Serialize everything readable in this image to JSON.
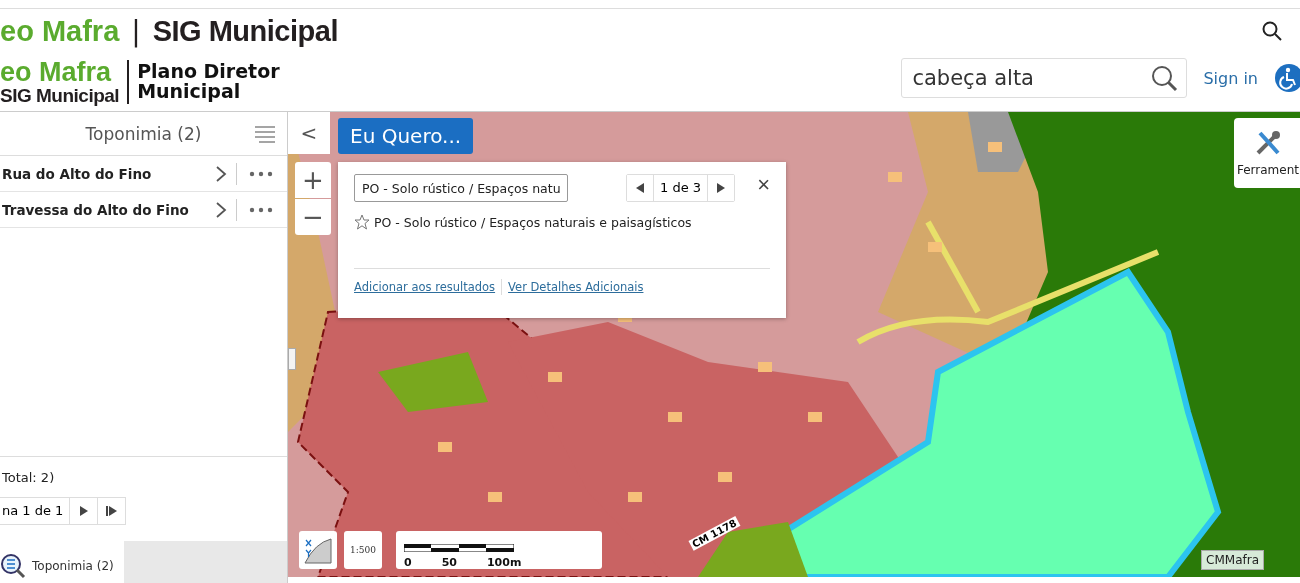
{
  "header": {
    "brand_top": {
      "green": "eo Mafra",
      "separator": "|",
      "black": "SIG Municipal"
    },
    "brand_bottom": {
      "green": "eo Mafra",
      "black": "SIG Municipal",
      "title_line1": "Plano Diretor",
      "title_line2": "Municipal"
    },
    "search": {
      "value": "cabeça alta"
    },
    "sign_in": "Sign in"
  },
  "sidebar": {
    "title": "Toponimia (2)",
    "items": [
      {
        "label": "Rua do Alto do Fino"
      },
      {
        "label": "Travessa do Alto do Fino"
      }
    ],
    "total": "Total: 2)",
    "page": "na 1 de 1",
    "tabs": [
      {
        "label": "Toponimia (2)",
        "selected": true
      }
    ]
  },
  "map": {
    "collapse": "<",
    "eu_quero": "Eu Quero...",
    "zoom_in": "+",
    "zoom_out": "−",
    "popup": {
      "select_value": "PO - Solo rústico / Espaços natu",
      "pager": "1 de 3",
      "close": "×",
      "feature": "PO - Solo rústico / Espaços naturais e paisagísticos",
      "links": [
        "Adicionar aos resultados",
        "Ver Detalhes Adicionais"
      ]
    },
    "tools": "Ferrament",
    "scale_button": "1:500",
    "scale_labels": [
      "0",
      "50",
      "100m"
    ],
    "road_label": "CM 1178",
    "attribution": "CMMafra"
  }
}
